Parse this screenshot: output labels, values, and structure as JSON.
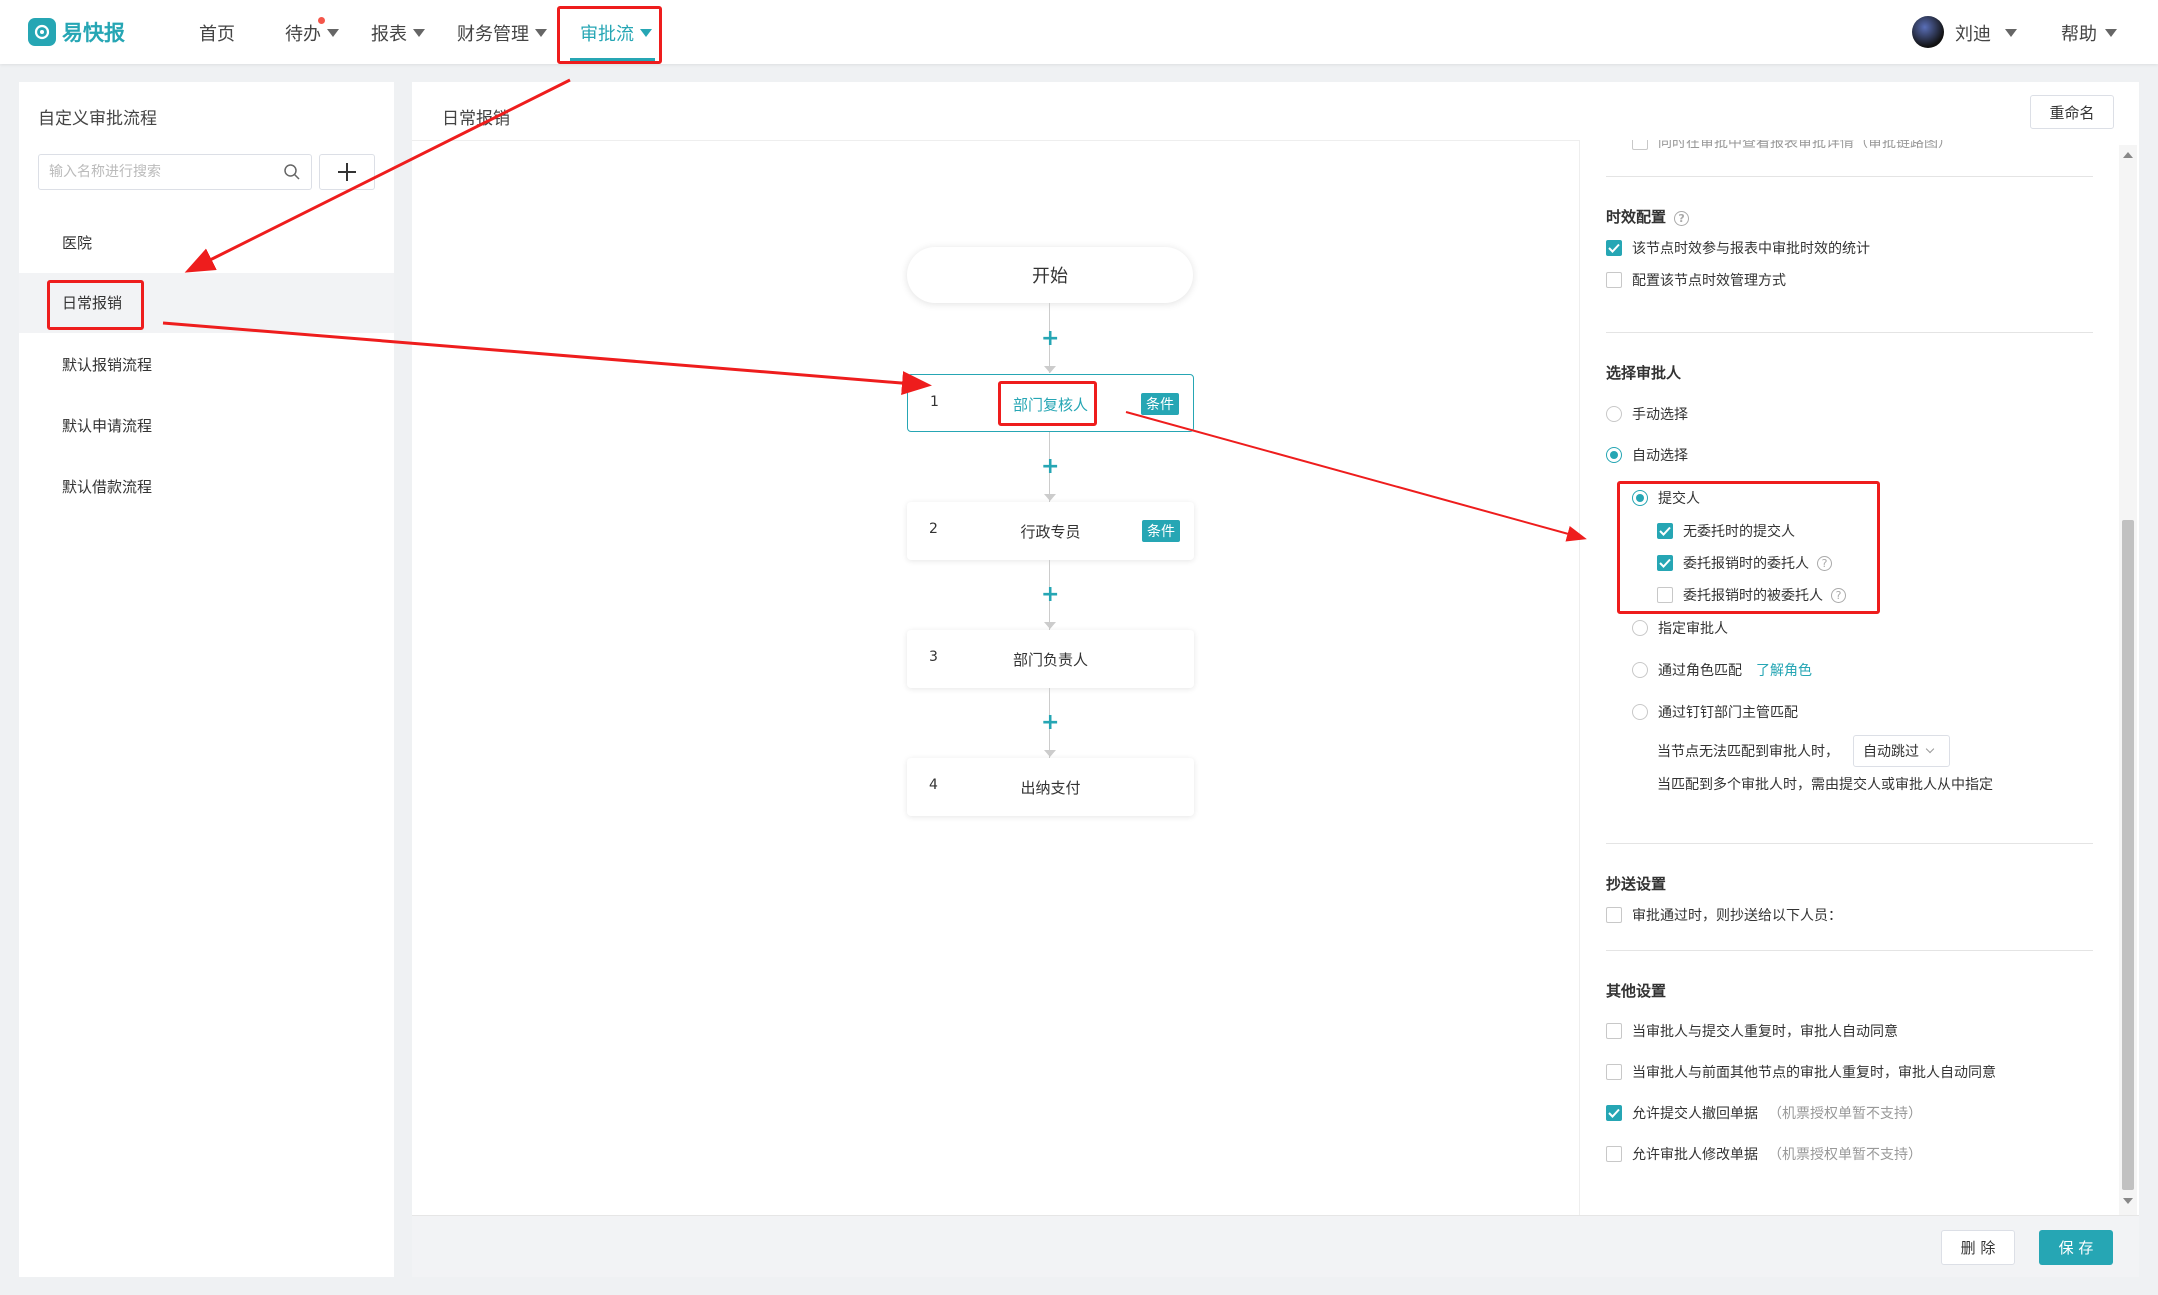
{
  "brand": {
    "name": "易快报",
    "color": "#26a6b4"
  },
  "nav": {
    "items": [
      {
        "label": "首页",
        "has_caret": false
      },
      {
        "label": "待办",
        "has_caret": true,
        "notification_dot": true
      },
      {
        "label": "报表",
        "has_caret": true
      },
      {
        "label": "财务管理",
        "has_caret": true
      },
      {
        "label": "审批流",
        "has_caret": true,
        "active": true
      }
    ],
    "user_name": "刘迪",
    "help_label": "帮助"
  },
  "left_panel": {
    "title": "自定义审批流程",
    "search_placeholder": "输入名称进行搜索",
    "add_icon": "plus-icon",
    "flows": [
      {
        "label": "医院"
      },
      {
        "label": "日常报销",
        "active": true
      },
      {
        "label": "默认报销流程"
      },
      {
        "label": "默认申请流程"
      },
      {
        "label": "默认借款流程"
      }
    ]
  },
  "main": {
    "title": "日常报销",
    "rename_label": "重命名",
    "start_label": "开始",
    "nodes": [
      {
        "index": "1",
        "name": "部门复核人",
        "badge": "条件",
        "selected": true
      },
      {
        "index": "2",
        "name": "行政专员",
        "badge": "条件"
      },
      {
        "index": "3",
        "name": "部门负责人"
      },
      {
        "index": "4",
        "name": "出纳支付"
      }
    ],
    "delete_label": "删 除",
    "save_label": "保 存"
  },
  "config": {
    "truncated_top_text": "同时在审批中查看报表审批详情（审批链路图）",
    "timing": {
      "title": "时效配置",
      "opt1": "该节点时效参与报表中审批时效的统计",
      "opt1_checked": true,
      "opt2": "配置该节点时效管理方式",
      "opt2_checked": false
    },
    "approver": {
      "title": "选择审批人",
      "manual": "手动选择",
      "auto": "自动选择",
      "submitter": "提交人",
      "sub_opt1": "无委托时的提交人",
      "sub_opt2": "委托报销时的委托人",
      "sub_opt3": "委托报销时的被委托人",
      "designated": "指定审批人",
      "role_match": "通过角色匹配",
      "role_link": "了解角色",
      "dingtalk_match": "通过钉钉部门主管匹配",
      "no_match_label": "当节点无法匹配到审批人时，",
      "no_match_value": "自动跳过",
      "multi_match_label": "当匹配到多个审批人时，需由提交人或审批人从中指定"
    },
    "cc": {
      "title": "抄送设置",
      "opt1": "审批通过时，则抄送给以下人员："
    },
    "other": {
      "title": "其他设置",
      "opt1": "当审批人与提交人重复时，审批人自动同意",
      "opt2": "当审批人与前面其他节点的审批人重复时，审批人自动同意",
      "opt3": "允许提交人撤回单据",
      "opt3_note": "（机票授权单暂不支持）",
      "opt3_checked": true,
      "opt4": "允许审批人修改单据",
      "opt4_note": "（机票授权单暂不支持）"
    }
  },
  "annotation_color": "#ee1d1d"
}
